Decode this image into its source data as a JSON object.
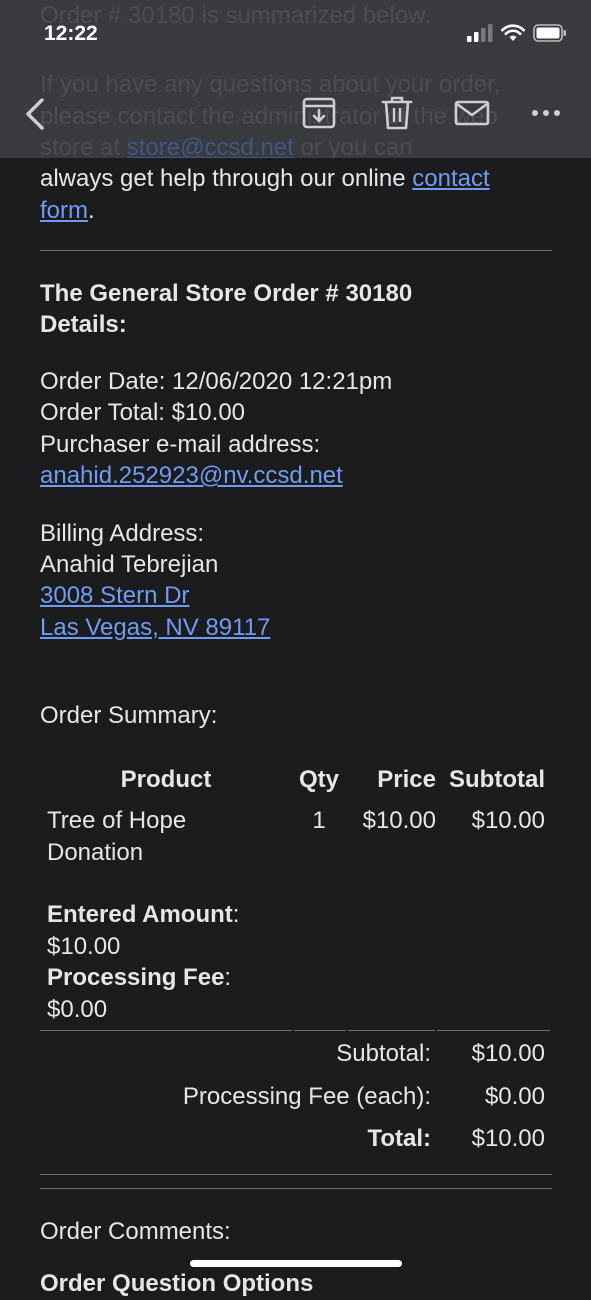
{
  "status_bar": {
    "time": "12:22"
  },
  "behind_toolbar": {
    "line1": "Order # 30180 is summarized below.",
    "line2": "If you have any questions about your order,",
    "line3": "please contact the administrator of the web",
    "line4_prefix": "store at ",
    "line4_link": "store@ccsd.net",
    "line4_suffix": " or you can"
  },
  "toolbar": {
    "back_icon": "chevron-left-icon",
    "archive_icon": "archive-icon",
    "trash_icon": "trash-icon",
    "mail_icon": "envelope-icon",
    "more_icon": "ellipsis-icon"
  },
  "email": {
    "help_text": "always get help through our online",
    "contact_link_1": "contact",
    "contact_link_2": "form",
    "period": ".",
    "order_heading_1": "The General Store Order # 30180",
    "order_heading_2": "Details:",
    "order_date": "Order Date: 12/06/2020 12:21pm",
    "order_total": "Order Total: $10.00",
    "purchaser_label": "Purchaser e-mail address:",
    "purchaser_email": "anahid.252923@nv.ccsd.net",
    "billing_label": "Billing Address:",
    "billing_name": "Anahid Tebrejian",
    "billing_street": "3008 Stern Dr",
    "billing_city": "Las Vegas, NV 89117",
    "summary_label": "Order Summary:",
    "table_headers": {
      "product": "Product",
      "qty": "Qty",
      "price": "Price",
      "subtotal": "Subtotal"
    },
    "item": {
      "product_1": "Tree of Hope",
      "product_2": "Donation",
      "qty": "1",
      "price": "$10.00",
      "subtotal": "$10.00",
      "entered_amount_label": "Entered Amount",
      "entered_amount_colon": ":",
      "entered_amount_value": "$10.00",
      "processing_fee_label": "Processing Fee",
      "processing_fee_colon": ":",
      "processing_fee_value": "$0.00"
    },
    "totals": {
      "subtotal_label": "Subtotal:",
      "subtotal_value": "$10.00",
      "fee_label": "Processing Fee (each):",
      "fee_value": "$0.00",
      "total_label": "Total:",
      "total_value": "$10.00"
    },
    "comments_label": "Order Comments:",
    "next_heading_partial": "Order Question Options"
  },
  "colors": {
    "link": "#6d9cf2",
    "background": "#1c1c1e",
    "toolbar": "#3a3b3f"
  }
}
